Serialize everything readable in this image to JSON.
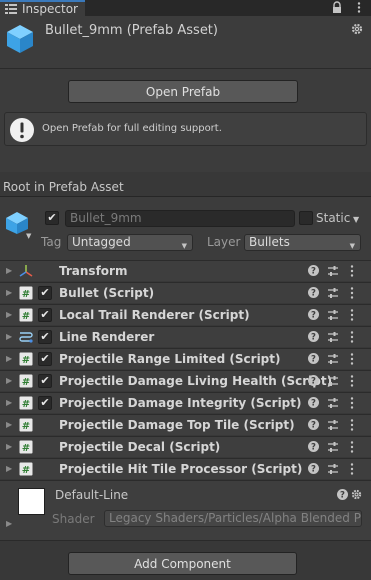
{
  "tab": {
    "title": "Inspector",
    "icon": "info-icon",
    "lock_icon": "lock-icon",
    "menu_icon": "kebab-menu-icon"
  },
  "header": {
    "title": "Bullet_9mm (Prefab Asset)",
    "icon": "prefab-cube-icon",
    "gear_icon": "gear-icon"
  },
  "prefab": {
    "open_button": "Open Prefab",
    "help_icon": "info-circle-icon",
    "help_text": "Open Prefab for full editing support."
  },
  "root_label": "Root in Prefab Asset",
  "object": {
    "icon": "prefab-cube-icon",
    "active": true,
    "name": "Bullet_9mm",
    "static_label": "Static",
    "static_checked": false,
    "tag_label": "Tag",
    "tag_value": "Untagged",
    "layer_label": "Layer",
    "layer_value": "Bullets"
  },
  "components": [
    {
      "label": "Transform",
      "icon": "transform-axes-icon",
      "has_checkbox": false,
      "checked": false
    },
    {
      "label": "Bullet (Script)",
      "icon": "csharp-script-icon",
      "has_checkbox": true,
      "checked": true
    },
    {
      "label": "Local Trail Renderer (Script)",
      "icon": "csharp-script-icon",
      "has_checkbox": true,
      "checked": true
    },
    {
      "label": "Line Renderer",
      "icon": "line-renderer-icon",
      "has_checkbox": true,
      "checked": true
    },
    {
      "label": "Projectile Range Limited (Script)",
      "icon": "csharp-script-icon",
      "has_checkbox": true,
      "checked": true
    },
    {
      "label": "Projectile Damage Living Health (Script)",
      "icon": "csharp-script-icon",
      "has_checkbox": true,
      "checked": true
    },
    {
      "label": "Projectile Damage Integrity (Script)",
      "icon": "csharp-script-icon",
      "has_checkbox": true,
      "checked": true
    },
    {
      "label": "Projectile Damage Top Tile (Script)",
      "icon": "csharp-script-icon",
      "has_checkbox": false,
      "checked": false
    },
    {
      "label": "Projectile Decal (Script)",
      "icon": "csharp-script-icon",
      "has_checkbox": false,
      "checked": false
    },
    {
      "label": "Projectile Hit Tile Processor (Script)",
      "icon": "csharp-script-icon",
      "has_checkbox": false,
      "checked": false
    }
  ],
  "material": {
    "name": "Default-Line",
    "shader_label": "Shader",
    "shader_value": "Legacy Shaders/Particles/Alpha Blended Premultiply",
    "help_icon": "help-icon",
    "gear_icon": "gear-icon"
  },
  "add_component_button": "Add Component",
  "colors": {
    "accent": "#3a79bb",
    "panel": "#3c3c3c",
    "background": "#383838"
  }
}
